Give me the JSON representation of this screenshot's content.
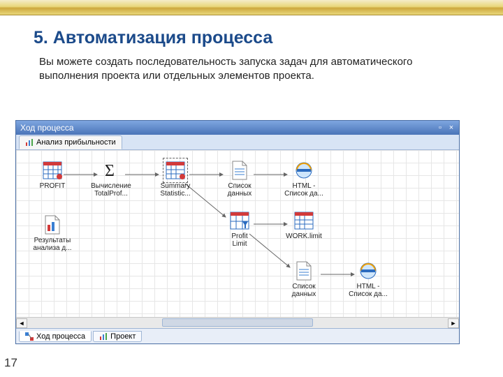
{
  "slide": {
    "heading": "5. Автоматизация процесса",
    "description": "Вы можете создать последовательность запуска задач для автоматического выполнения проекта или отдельных элементов проекта.",
    "page_number": "17"
  },
  "window": {
    "title": "Ход процесса",
    "pin_label": "▫",
    "close_label": "×"
  },
  "tabs_top": [
    {
      "label": "Анализ прибыльности"
    }
  ],
  "nodes": {
    "profit": {
      "label": "PROFIT"
    },
    "totalprof": {
      "label": "Вычисление\nTotalProf..."
    },
    "summary": {
      "label": "Summary\nStatistic..."
    },
    "datalist1": {
      "label": "Список\nданных"
    },
    "html1": {
      "label": "HTML -\nСписок да..."
    },
    "results": {
      "label": "Результаты\nанализа д..."
    },
    "profitlim": {
      "label": "Profit\nLimit"
    },
    "worklimit": {
      "label": "WORK.limit"
    },
    "datalist2": {
      "label": "Список\nданных"
    },
    "html2": {
      "label": "HTML -\nСписок да..."
    }
  },
  "tabs_bottom": [
    {
      "label": "Ход процесса",
      "active": true
    },
    {
      "label": "Проект",
      "active": false
    }
  ],
  "scrollbar": {
    "left_arrow": "◄",
    "right_arrow": "►"
  }
}
